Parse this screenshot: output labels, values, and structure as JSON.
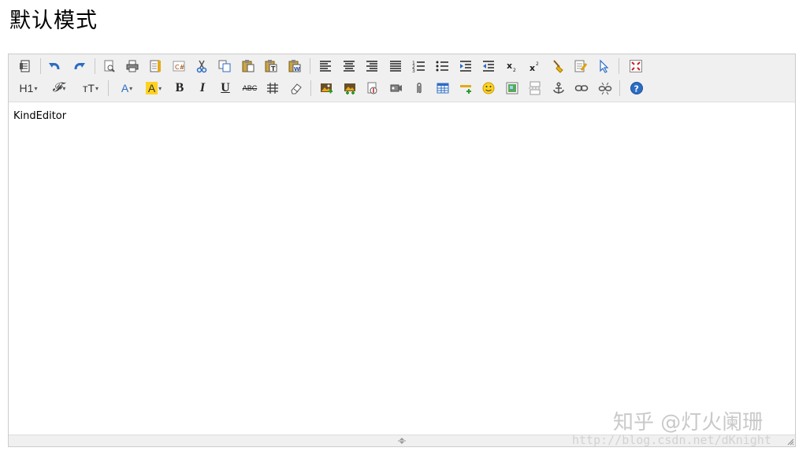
{
  "page": {
    "title": "默认模式"
  },
  "editor": {
    "content": "KindEditor"
  },
  "toolbar": {
    "heading": "H1",
    "font_name": "𝓕",
    "font_size": "тT",
    "fore_color": "A",
    "hilite_color": "A",
    "bold": "B",
    "italic": "I",
    "underline": "U",
    "strikethrough": "ABC"
  },
  "watermark": {
    "text": "知乎 @灯火阑珊",
    "url": "http://blog.csdn.net/dKnight"
  },
  "colors": {
    "toolbar_bg": "#f0f0f0",
    "border": "#cccccc",
    "icon_blue": "#2b6cc4",
    "hilite_yellow": "#ffd21f"
  }
}
